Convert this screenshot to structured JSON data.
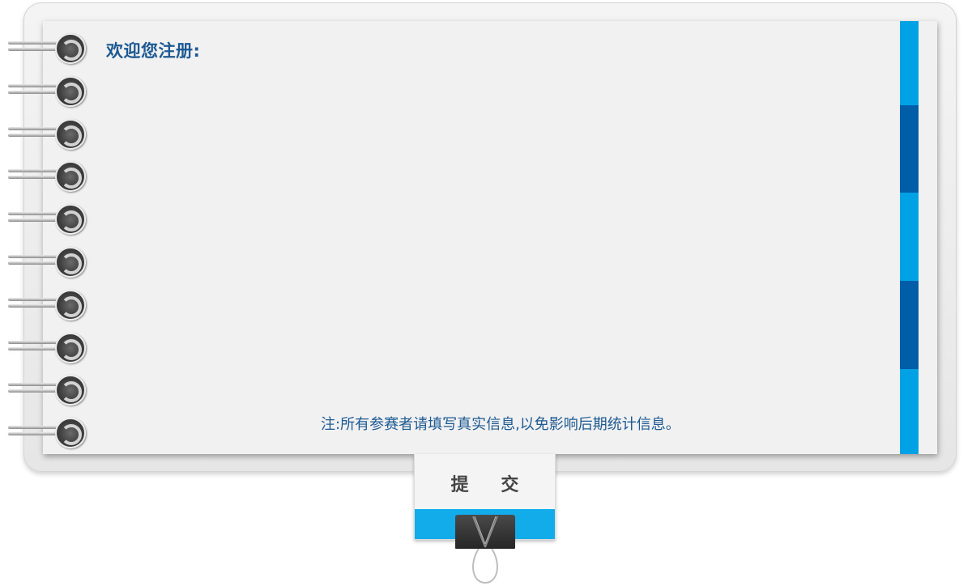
{
  "form": {
    "welcome_text": "欢迎您注册:",
    "note_text": "注:所有参赛者请填写真实信息,以免影响后期统计信息。",
    "submit_label": "提 交"
  },
  "notebook": {
    "ring_count": 10,
    "tab_colors": [
      "#00a2e6",
      "#005ea8",
      "#00a2e6",
      "#005ea8",
      "#00a2e6"
    ]
  },
  "icons": {
    "spiral": "spiral-ring-icon",
    "clip": "binder-clip-icon"
  },
  "colors": {
    "title": "#1d5a93",
    "accent": "#12aceb",
    "accent_dark": "#005ea8"
  }
}
